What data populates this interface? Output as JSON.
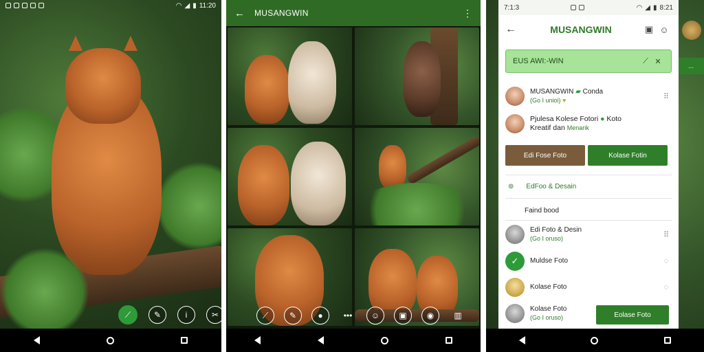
{
  "colors": {
    "accent": "#2f7f2a",
    "appbar": "#2f6b24",
    "brown_button": "#7a5c3c",
    "search_bg": "#a8e39a"
  },
  "panel1": {
    "statusbar": {
      "time": "11:20"
    },
    "actions": [
      {
        "icon": "leaf-icon"
      },
      {
        "icon": "edit-icon"
      },
      {
        "icon": "info-icon"
      },
      {
        "icon": "share-icon"
      }
    ]
  },
  "panel2": {
    "appbar": {
      "title": "MUSANGWIN",
      "back_icon": "arrow-back-icon",
      "more_icon": "more-vert-icon"
    },
    "actions": [
      {
        "icon": "leaf-icon"
      },
      {
        "icon": "edit-icon"
      },
      {
        "icon": "mic-icon"
      },
      {
        "icon": "more-horiz-icon"
      },
      {
        "icon": "emoji-icon"
      },
      {
        "icon": "image-icon"
      },
      {
        "icon": "camera-icon"
      },
      {
        "icon": "trash-icon"
      }
    ]
  },
  "panel3": {
    "statusbar": {
      "time_left": "7:1:3",
      "time_right": "8:21"
    },
    "topbar": {
      "title": "MUSANGWIN"
    },
    "search": {
      "text": "EUS AWI:-WIN"
    },
    "item1": {
      "name": "MUSANGWIN",
      "tag": "Conda",
      "sub": "(Go I unioi)"
    },
    "item2": {
      "line1": "Pjulesa Kolese Fotori",
      "line1b": "Koto",
      "line2": "Kreatif dan",
      "line2b": "Menarik"
    },
    "buttons": {
      "edit": "Edi Fose Foto",
      "collage": "Kolase Fotin"
    },
    "section": {
      "label": "EdFoo & Desain",
      "feed": "Faind bood"
    },
    "list": [
      {
        "title": "Edi Foto & Desin",
        "sub": "(Go I oruso)"
      },
      {
        "title": "Muldse Foto"
      },
      {
        "title": "Kolase Foto"
      },
      {
        "title": "Kolase Foto",
        "sub": "(Go I oruso)"
      }
    ],
    "bottom_button": "Eolase Foto",
    "side_chip": "..."
  }
}
